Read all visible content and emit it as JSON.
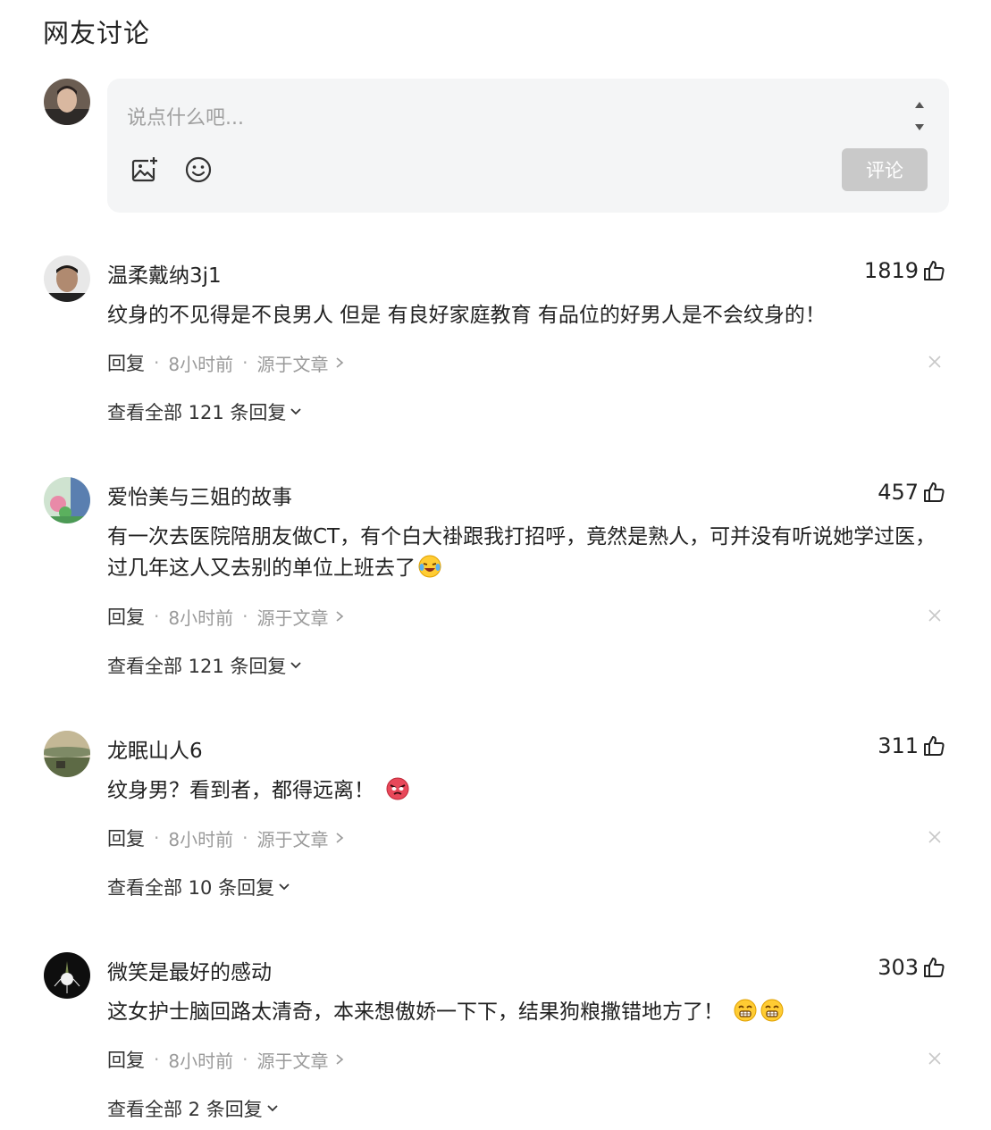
{
  "section_title": "网友讨论",
  "composer": {
    "placeholder": "说点什么吧...",
    "submit_label": "评论"
  },
  "comments": [
    {
      "user": "温柔戴纳3j1",
      "likes": "1819",
      "text": "纹身的不见得是不良男人 但是 有良好家庭教育 有品位的好男人是不会纹身的！",
      "emojis": [],
      "reply_label": "回复",
      "time": "8小时前",
      "source": "源于文章",
      "replies_label": "查看全部 121 条回复"
    },
    {
      "user": "爱怡美与三姐的故事",
      "likes": "457",
      "text": "有一次去医院陪朋友做CT，有个白大褂跟我打招呼，竟然是熟人，可并没有听说她学过医，过几年这人又去别的单位上班去了",
      "emojis": [
        "laughing-crying-emoji"
      ],
      "reply_label": "回复",
      "time": "8小时前",
      "source": "源于文章",
      "replies_label": "查看全部 121 条回复"
    },
    {
      "user": "龙眠山人6",
      "likes": "311",
      "text": "纹身男？看到者，都得远离！",
      "emojis": [
        "angry-emoji"
      ],
      "reply_label": "回复",
      "time": "8小时前",
      "source": "源于文章",
      "replies_label": "查看全部 10 条回复"
    },
    {
      "user": "微笑是最好的感动",
      "likes": "303",
      "text": "这女护士脑回路太清奇，本来想傲娇一下下，结果狗粮撒错地方了！",
      "emojis": [
        "grin-emoji",
        "grin-emoji"
      ],
      "reply_label": "回复",
      "time": "8小时前",
      "source": "源于文章",
      "replies_label": "查看全部 2 条回复"
    }
  ]
}
